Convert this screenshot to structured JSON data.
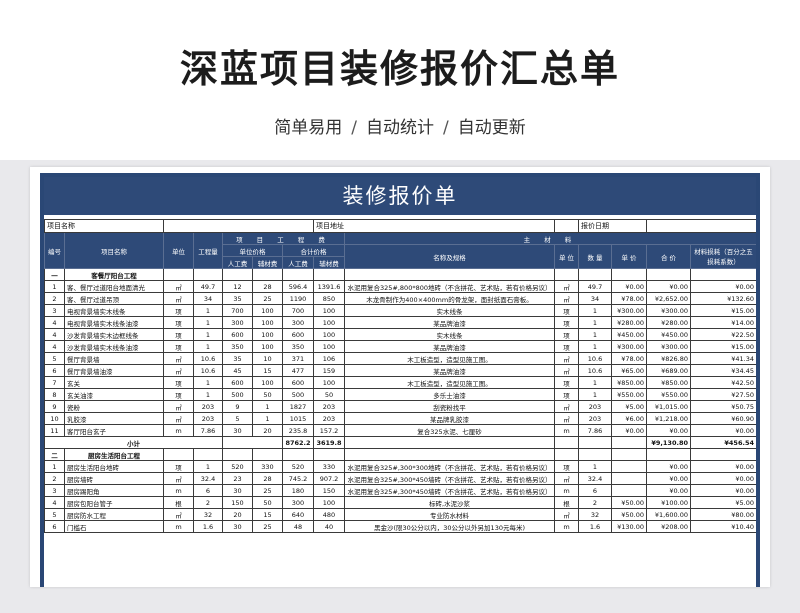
{
  "hero": {
    "title": "深蓝项目装修报价汇总单",
    "tags": [
      "简单易用",
      "自动统计",
      "自动更新"
    ],
    "separator": "/"
  },
  "sheet": {
    "title": "装修报价单",
    "info": {
      "project_name_label": "项目名称",
      "project_address_label": "项目地址",
      "quote_date_label": "报价日期"
    },
    "headers": {
      "index": "编号",
      "item_name": "项目名称",
      "unit": "单位",
      "quantity": "工程量",
      "project_fee": "项 目 工 程 费",
      "unit_price": "单位价格",
      "total_price": "合计价格",
      "labor": "人工费",
      "aux": "辅材费",
      "main_material": "主 材 料",
      "name_spec": "名称及规格",
      "m_unit": "单 位",
      "m_qty": "数 量",
      "m_price": "单 价",
      "m_total": "合 价",
      "loss": "材料损耗（百分之五损耗系数）"
    },
    "sections": [
      {
        "no": "一",
        "name": "客餐厅阳台工程",
        "rows": [
          {
            "no": "1",
            "name": "客、餐厅过道阳台地面清光",
            "unit": "㎡",
            "qty": "49.7",
            "labor": "12",
            "aux": "28",
            "labor_total": "596.4",
            "aux_total": "1391.6",
            "spec": "水泥用复合325#,800*800地砖（不含拼花、艺术贴，若有价格另议）",
            "m_unit": "㎡",
            "m_qty": "49.7",
            "m_price": "¥0.00",
            "m_total": "¥0.00",
            "loss": "¥0.00"
          },
          {
            "no": "2",
            "name": "客、餐厅过道吊顶",
            "unit": "㎡",
            "qty": "34",
            "labor": "35",
            "aux": "25",
            "labor_total": "1190",
            "aux_total": "850",
            "spec": "木龙骨制作为400×400mm的骨龙架，面封纸面石膏板。",
            "m_unit": "㎡",
            "m_qty": "34",
            "m_price": "¥78.00",
            "m_total": "¥2,652.00",
            "loss": "¥132.60"
          },
          {
            "no": "3",
            "name": "电视背景墙实木线条",
            "unit": "项",
            "qty": "1",
            "labor": "700",
            "aux": "100",
            "labor_total": "700",
            "aux_total": "100",
            "spec": "实木线条",
            "m_unit": "项",
            "m_qty": "1",
            "m_price": "¥300.00",
            "m_total": "¥300.00",
            "loss": "¥15.00"
          },
          {
            "no": "4",
            "name": "电视背景墙实木线条油漆",
            "unit": "项",
            "qty": "1",
            "labor": "300",
            "aux": "100",
            "labor_total": "300",
            "aux_total": "100",
            "spec": "某品牌油漆",
            "m_unit": "项",
            "m_qty": "1",
            "m_price": "¥280.00",
            "m_total": "¥280.00",
            "loss": "¥14.00"
          },
          {
            "no": "4",
            "name": "沙发背景墙实木边框线条",
            "unit": "项",
            "qty": "1",
            "labor": "600",
            "aux": "100",
            "labor_total": "600",
            "aux_total": "100",
            "spec": "实木线条",
            "m_unit": "项",
            "m_qty": "1",
            "m_price": "¥450.00",
            "m_total": "¥450.00",
            "loss": "¥22.50"
          },
          {
            "no": "4",
            "name": "沙发背景墙实木线条油漆",
            "unit": "项",
            "qty": "1",
            "labor": "350",
            "aux": "100",
            "labor_total": "350",
            "aux_total": "100",
            "spec": "某品牌油漆",
            "m_unit": "项",
            "m_qty": "1",
            "m_price": "¥300.00",
            "m_total": "¥300.00",
            "loss": "¥15.00"
          },
          {
            "no": "5",
            "name": "餐厅背景墙",
            "unit": "㎡",
            "qty": "10.6",
            "labor": "35",
            "aux": "10",
            "labor_total": "371",
            "aux_total": "106",
            "spec": "木工板造型，造型见施工图。",
            "m_unit": "㎡",
            "m_qty": "10.6",
            "m_price": "¥78.00",
            "m_total": "¥826.80",
            "loss": "¥41.34"
          },
          {
            "no": "6",
            "name": "餐厅背景墙油漆",
            "unit": "㎡",
            "qty": "10.6",
            "labor": "45",
            "aux": "15",
            "labor_total": "477",
            "aux_total": "159",
            "spec": "某品牌油漆",
            "m_unit": "㎡",
            "m_qty": "10.6",
            "m_price": "¥65.00",
            "m_total": "¥689.00",
            "loss": "¥34.45"
          },
          {
            "no": "7",
            "name": "玄关",
            "unit": "项",
            "qty": "1",
            "labor": "600",
            "aux": "100",
            "labor_total": "600",
            "aux_total": "100",
            "spec": "木工板造型，造型见施工图。",
            "m_unit": "项",
            "m_qty": "1",
            "m_price": "¥850.00",
            "m_total": "¥850.00",
            "loss": "¥42.50"
          },
          {
            "no": "8",
            "name": "玄关油漆",
            "unit": "项",
            "qty": "1",
            "labor": "500",
            "aux": "50",
            "labor_total": "500",
            "aux_total": "50",
            "spec": "多乐士油漆",
            "m_unit": "项",
            "m_qty": "1",
            "m_price": "¥550.00",
            "m_total": "¥550.00",
            "loss": "¥27.50"
          },
          {
            "no": "9",
            "name": "瓷粉",
            "unit": "㎡",
            "qty": "203",
            "labor": "9",
            "aux": "1",
            "labor_total": "1827",
            "aux_total": "203",
            "spec": "刮瓷粉找平",
            "m_unit": "㎡",
            "m_qty": "203",
            "m_price": "¥5.00",
            "m_total": "¥1,015.00",
            "loss": "¥50.75"
          },
          {
            "no": "10",
            "name": "乳胶漆",
            "unit": "㎡",
            "qty": "203",
            "labor": "5",
            "aux": "1",
            "labor_total": "1015",
            "aux_total": "203",
            "spec": "某品牌乳胶漆",
            "m_unit": "㎡",
            "m_qty": "203",
            "m_price": "¥6.00",
            "m_total": "¥1,218.00",
            "loss": "¥60.90"
          },
          {
            "no": "11",
            "name": "客厅阳台玄子",
            "unit": "m",
            "qty": "7.86",
            "labor": "30",
            "aux": "20",
            "labor_total": "235.8",
            "aux_total": "157.2",
            "spec": "复合325水泥、七厘砂",
            "m_unit": "m",
            "m_qty": "7.86",
            "m_price": "¥0.00",
            "m_total": "¥0.00",
            "loss": "¥0.00"
          }
        ],
        "subtotal": {
          "label": "小计",
          "labor_total": "8762.2",
          "aux_total": "3619.8",
          "m_total": "¥9,130.80",
          "loss": "¥456.54"
        }
      },
      {
        "no": "二",
        "name": "厨房生活阳台工程",
        "rows": [
          {
            "no": "1",
            "name": "厨房生活阳台地砖",
            "unit": "项",
            "qty": "1",
            "labor": "520",
            "aux": "330",
            "labor_total": "520",
            "aux_total": "330",
            "spec": "水泥用复合325#,300*300地砖（不含拼花、艺术贴，若有价格另议）",
            "m_unit": "项",
            "m_qty": "1",
            "m_price": "",
            "m_total": "¥0.00",
            "loss": "¥0.00"
          },
          {
            "no": "2",
            "name": "厨房墙砖",
            "unit": "㎡",
            "qty": "32.4",
            "labor": "23",
            "aux": "28",
            "labor_total": "745.2",
            "aux_total": "907.2",
            "spec": "水泥用复合325#,300*450墙砖（不含拼花、艺术贴，若有价格另议）",
            "m_unit": "㎡",
            "m_qty": "32.4",
            "m_price": "",
            "m_total": "¥0.00",
            "loss": "¥0.00"
          },
          {
            "no": "3",
            "name": "厨房踢阳角",
            "unit": "m",
            "qty": "6",
            "labor": "30",
            "aux": "25",
            "labor_total": "180",
            "aux_total": "150",
            "spec": "水泥用复合325#,300*450墙砖（不含拼花、艺术贴，若有价格另议）",
            "m_unit": "m",
            "m_qty": "6",
            "m_price": "",
            "m_total": "¥0.00",
            "loss": "¥0.00"
          },
          {
            "no": "4",
            "name": "厨房包阳台管子",
            "unit": "根",
            "qty": "2",
            "labor": "150",
            "aux": "50",
            "labor_total": "300",
            "aux_total": "100",
            "spec": "标砖,水泥沙浆",
            "m_unit": "根",
            "m_qty": "2",
            "m_price": "¥50.00",
            "m_total": "¥100.00",
            "loss": "¥5.00"
          },
          {
            "no": "5",
            "name": "厨房防水工程",
            "unit": "㎡",
            "qty": "32",
            "labor": "20",
            "aux": "15",
            "labor_total": "640",
            "aux_total": "480",
            "spec": "专业防水材料",
            "m_unit": "㎡",
            "m_qty": "32",
            "m_price": "¥50.00",
            "m_total": "¥1,600.00",
            "loss": "¥80.00"
          },
          {
            "no": "6",
            "name": "门槛石",
            "unit": "m",
            "qty": "1.6",
            "labor": "30",
            "aux": "25",
            "labor_total": "48",
            "aux_total": "40",
            "spec": "黑金沙(限30公分以内，30公分以外另加130元每米)",
            "m_unit": "m",
            "m_qty": "1.6",
            "m_price": "¥130.00",
            "m_total": "¥208.00",
            "loss": "¥10.40"
          }
        ]
      }
    ]
  },
  "colors": {
    "header_blue": "#2e4a78",
    "frame_blue": "#2a4775",
    "backdrop_gray": "#e9e9ec"
  }
}
